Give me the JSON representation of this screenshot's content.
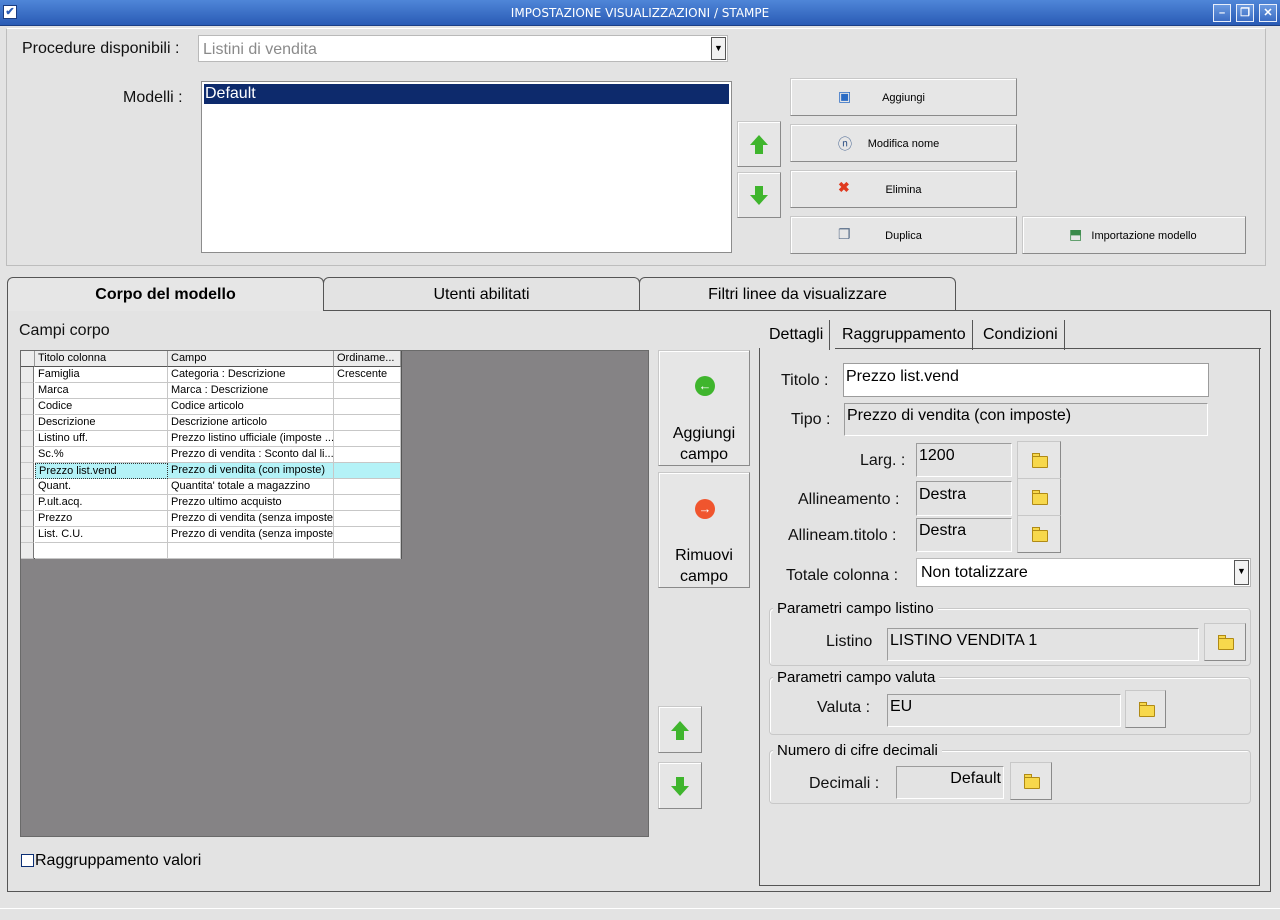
{
  "window": {
    "title": "IMPOSTAZIONE VISUALIZZAZIONI / STAMPE",
    "icon_check": "✔",
    "minimize": "–",
    "restore": "❐",
    "close": "✕"
  },
  "procedures": {
    "label": "Procedure disponibili :",
    "value": "Listini di vendita",
    "arrow": "▼"
  },
  "models": {
    "label": "Modelli :",
    "items": [
      "Default"
    ],
    "selected": "Default"
  },
  "model_buttons": {
    "add": "Aggiungi",
    "rename": "Modifica nome",
    "delete": "Elimina",
    "duplicate": "Duplica",
    "import": "Importazione modello"
  },
  "tabs": {
    "body": "Corpo del modello",
    "users": "Utenti abilitati",
    "filters": "Filtri linee da visualizzare"
  },
  "body_fields": {
    "label": "Campi corpo",
    "columns": [
      "Titolo colonna",
      "Campo",
      "Ordiname..."
    ],
    "rows": [
      {
        "title": "Famiglia",
        "field": "Categoria : Descrizione",
        "order": "Crescente"
      },
      {
        "title": "Marca",
        "field": "Marca : Descrizione",
        "order": ""
      },
      {
        "title": "Codice",
        "field": "Codice articolo",
        "order": ""
      },
      {
        "title": "Descrizione",
        "field": "Descrizione articolo",
        "order": ""
      },
      {
        "title": "Listino uff.",
        "field": "Prezzo listino ufficiale (imposte ...",
        "order": ""
      },
      {
        "title": "Sc.%",
        "field": "Prezzo di vendita : Sconto dal li...",
        "order": ""
      },
      {
        "title": "Prezzo list.vend",
        "field": "Prezzo di vendita (con imposte)",
        "order": ""
      },
      {
        "title": "Quant.",
        "field": "Quantita' totale a magazzino",
        "order": ""
      },
      {
        "title": "P.ult.acq.",
        "field": "Prezzo ultimo acquisto",
        "order": ""
      },
      {
        "title": "Prezzo",
        "field": "Prezzo di vendita (senza imposte)",
        "order": ""
      },
      {
        "title": "List. C.U.",
        "field": "Prezzo di vendita (senza imposte)",
        "order": ""
      },
      {
        "title": "",
        "field": "",
        "order": ""
      }
    ],
    "selected_row": 6
  },
  "field_buttons": {
    "add_line1": "Aggiungi",
    "add_line2": "campo",
    "remove_line1": "Rimuovi",
    "remove_line2": "campo",
    "add_icon": "←",
    "remove_icon": "→"
  },
  "group_values": {
    "label": "Raggruppamento valori",
    "checked": false
  },
  "detail_tabs": {
    "details": "Dettagli",
    "grouping": "Raggruppamento",
    "conditions": "Condizioni"
  },
  "details": {
    "title_label": "Titolo :",
    "title_value": "Prezzo list.vend",
    "type_label": "Tipo :",
    "type_value": "Prezzo di vendita (con imposte)",
    "width_label": "Larg. :",
    "width_value": "1200",
    "align_label": "Allineamento :",
    "align_value": "Destra",
    "title_align_label": "Allineam.titolo :",
    "title_align_value": "Destra",
    "total_label": "Totale colonna :",
    "total_value": "Non totalizzare",
    "total_arrow": "▼"
  },
  "price_list_params": {
    "group": "Parametri campo listino",
    "label": "Listino",
    "value": "LISTINO VENDITA 1"
  },
  "currency_params": {
    "group": "Parametri campo valuta",
    "label": "Valuta :",
    "value": "EU"
  },
  "decimals": {
    "group": "Numero di cifre decimali",
    "label": "Decimali :",
    "value": "Default"
  },
  "colors": {
    "titlebar": "#2a5bb5",
    "selection": "#0d2a6c",
    "grid_selected": "#b4f2f7",
    "grid_background": "#858385",
    "arrow_green": "#3fb52d",
    "remove_orange": "#f0552e"
  }
}
